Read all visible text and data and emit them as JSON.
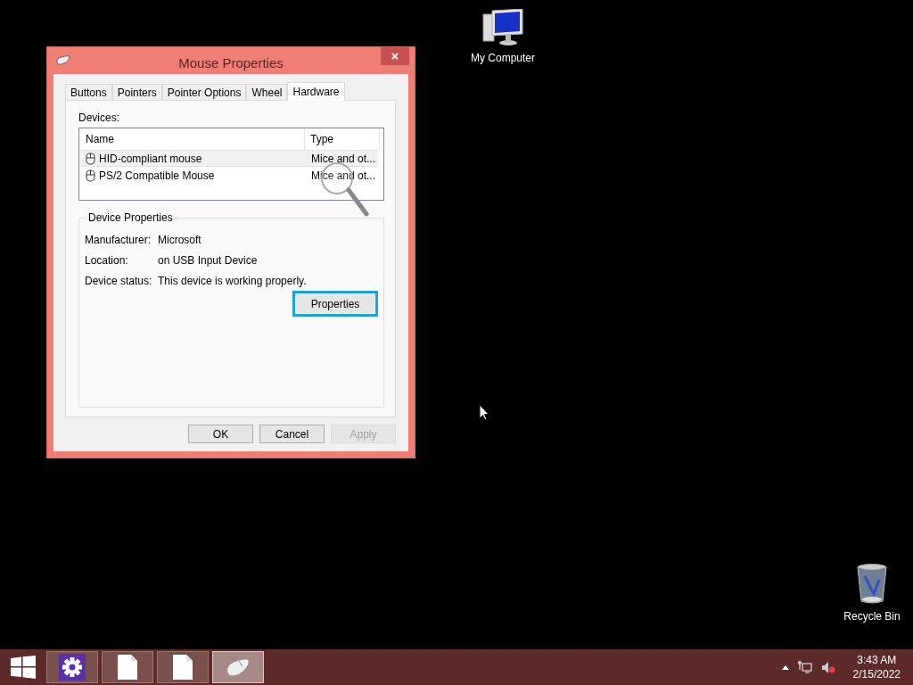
{
  "desktop_icons": [
    {
      "kind": "computer",
      "label": "My Computer"
    },
    {
      "kind": "recycle",
      "label": "Recycle Bin"
    }
  ],
  "window": {
    "title": "Mouse Properties",
    "close": "×"
  },
  "tabs": [
    {
      "label": "Buttons",
      "selected": false
    },
    {
      "label": "Pointers",
      "selected": false
    },
    {
      "label": "Pointer Options",
      "selected": false
    },
    {
      "label": "Wheel",
      "selected": false
    },
    {
      "label": "Hardware",
      "selected": true
    }
  ],
  "devices": {
    "label": "Devices:",
    "columns": [
      "Name",
      "Type"
    ],
    "rows": [
      {
        "name": "HID-compliant mouse",
        "type": "Mice and ot...",
        "selected": true
      },
      {
        "name": "PS/2 Compatible Mouse",
        "type": "Mice and ot...",
        "selected": false
      }
    ]
  },
  "device_properties": {
    "title": "Device Properties",
    "fields": [
      {
        "label": "Manufacturer:",
        "value": "Microsoft"
      },
      {
        "label": "Location:",
        "value": "on USB Input Device"
      },
      {
        "label": "Device status:",
        "value": "This device is working properly."
      }
    ],
    "button": {
      "label": "Properties",
      "focused": true
    }
  },
  "buttons": [
    {
      "label": "OK",
      "disabled": false
    },
    {
      "label": "Cancel",
      "disabled": false
    },
    {
      "label": "Apply",
      "disabled": true
    }
  ],
  "taskbar": {
    "items": [
      {
        "kind": "start",
        "active": false
      },
      {
        "kind": "settings",
        "active": false
      },
      {
        "kind": "document",
        "active": false
      },
      {
        "kind": "document",
        "active": false
      },
      {
        "kind": "mouse",
        "active": true
      }
    ],
    "time": "3:43 AM",
    "date": "2/15/2022"
  }
}
